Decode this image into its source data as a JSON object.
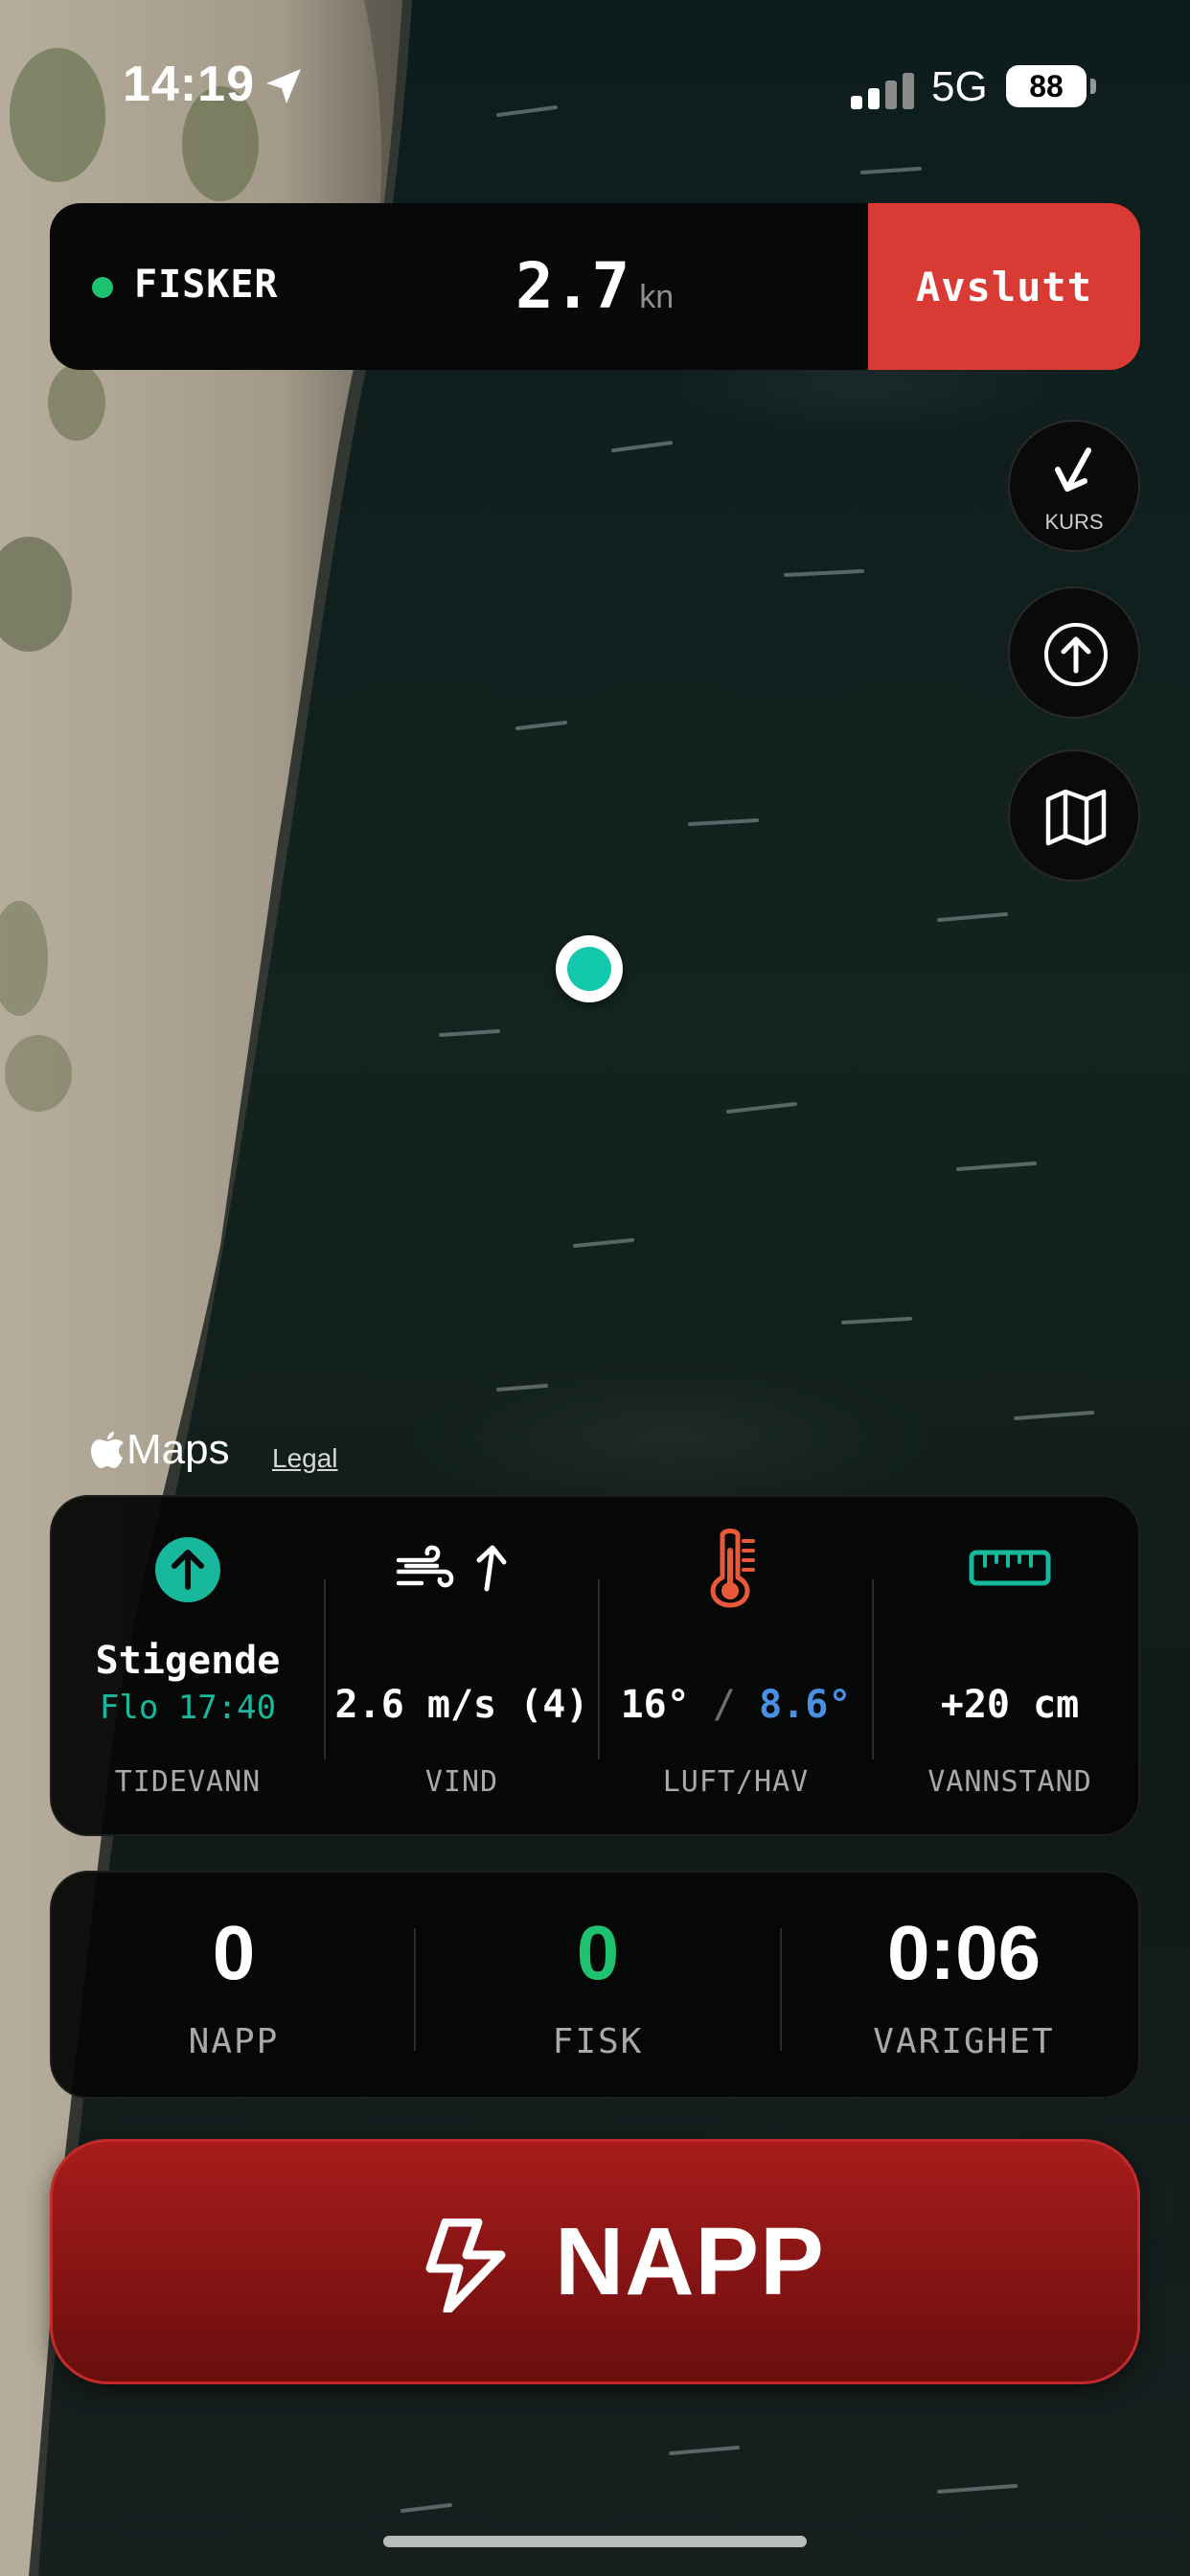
{
  "status_bar": {
    "time": "14:19",
    "network": "5G",
    "battery": "88",
    "icons": [
      "location-arrow-icon",
      "signal-bars-icon",
      "battery-icon"
    ]
  },
  "session": {
    "status_label": "FISKER",
    "status_color": "#1ec26e",
    "speed_value": "2.7",
    "speed_unit": "kn",
    "end_label": "Avslutt",
    "end_color": "#d93a33"
  },
  "map_controls": {
    "course_label": "KURS",
    "icons": [
      "course-arrow-icon",
      "recenter-icon",
      "map-type-icon"
    ]
  },
  "map": {
    "attribution": "Maps",
    "legal": "Legal",
    "marker_color": "#12c8ad"
  },
  "conditions": {
    "tide": {
      "state": "Stigende",
      "next": "Flo 17:40",
      "label": "TIDEVANN",
      "icon": "tide-rising-icon",
      "color": "#17b89c"
    },
    "wind": {
      "value": "2.6 m/s (4)",
      "label": "VIND",
      "icons": [
        "wind-icon",
        "wind-direction-arrow-icon"
      ]
    },
    "temperature": {
      "air": "16°",
      "separator": "/",
      "sea": "8.6°",
      "label": "LUFT/HAV",
      "icon": "thermometer-icon",
      "sea_color": "#4a90e2",
      "icon_color": "#e8593a"
    },
    "water_level": {
      "value": "+20 cm",
      "label": "VANNSTAND",
      "icon": "ruler-icon"
    }
  },
  "stats": {
    "bites_value": "0",
    "bites_label": "NAPP",
    "fish_value": "0",
    "fish_label": "FISK",
    "fish_color": "#1ec26e",
    "duration_value": "0:06",
    "duration_label": "VARIGHET"
  },
  "action": {
    "label": "NAPP",
    "icon": "lightning-bolt-icon",
    "color": "#a81c1c"
  }
}
